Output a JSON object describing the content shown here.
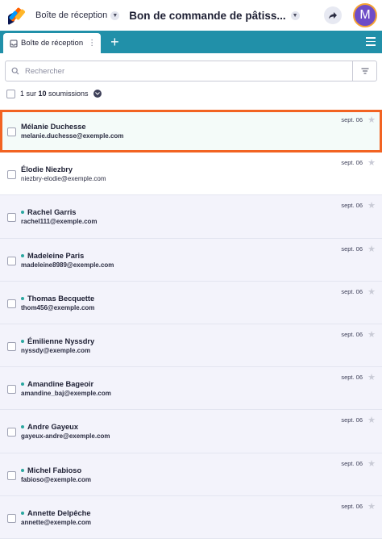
{
  "header": {
    "breadcrumb_label": "Boîte de réception",
    "form_title": "Bon de commande de pâtiss...",
    "avatar_letter": "M",
    "colors": {
      "avatar_bg": "#6e4cc7",
      "avatar_ring": "#f5a233"
    }
  },
  "tabs": {
    "active_tab_label": "Boîte de réception",
    "add_label": "+",
    "color": "#2190a9"
  },
  "search": {
    "placeholder": "Rechercher"
  },
  "summary": {
    "prefix": "1 sur ",
    "count": "10",
    "suffix": " soumissions"
  },
  "submissions": [
    {
      "name": "Mélanie Duchesse",
      "email": "melanie.duchesse@exemple.com",
      "date": "sept. 06",
      "unread": false,
      "selected": true
    },
    {
      "name": "Élodie Niezbry",
      "email": "niezbry-elodie@exemple.com",
      "date": "sept. 06",
      "unread": false,
      "selected": false
    },
    {
      "name": "Rachel Garris",
      "email": "rachel111@exemple.com",
      "date": "sept. 06",
      "unread": true,
      "selected": false
    },
    {
      "name": "Madeleine Paris",
      "email": "madeleine8989@exemple.com",
      "date": "sept. 06",
      "unread": true,
      "selected": false
    },
    {
      "name": "Thomas Becquette",
      "email": "thom456@exemple.com",
      "date": "sept. 06",
      "unread": true,
      "selected": false
    },
    {
      "name": "Émilienne Nyssdry",
      "email": "nyssdy@exemple.com",
      "date": "sept. 06",
      "unread": true,
      "selected": false
    },
    {
      "name": "Amandine Bageoir",
      "email": "amandine_baj@exemple.com",
      "date": "sept. 06",
      "unread": true,
      "selected": false
    },
    {
      "name": "Andre Gayeux",
      "email": "gayeux-andre@exemple.com",
      "date": "sept. 06",
      "unread": true,
      "selected": false
    },
    {
      "name": "Michel Fabioso",
      "email": "fabioso@exemple.com",
      "date": "sept. 06",
      "unread": true,
      "selected": false
    },
    {
      "name": "Annette Delpêche",
      "email": "annette@exemple.com",
      "date": "sept. 06",
      "unread": true,
      "selected": false
    }
  ]
}
